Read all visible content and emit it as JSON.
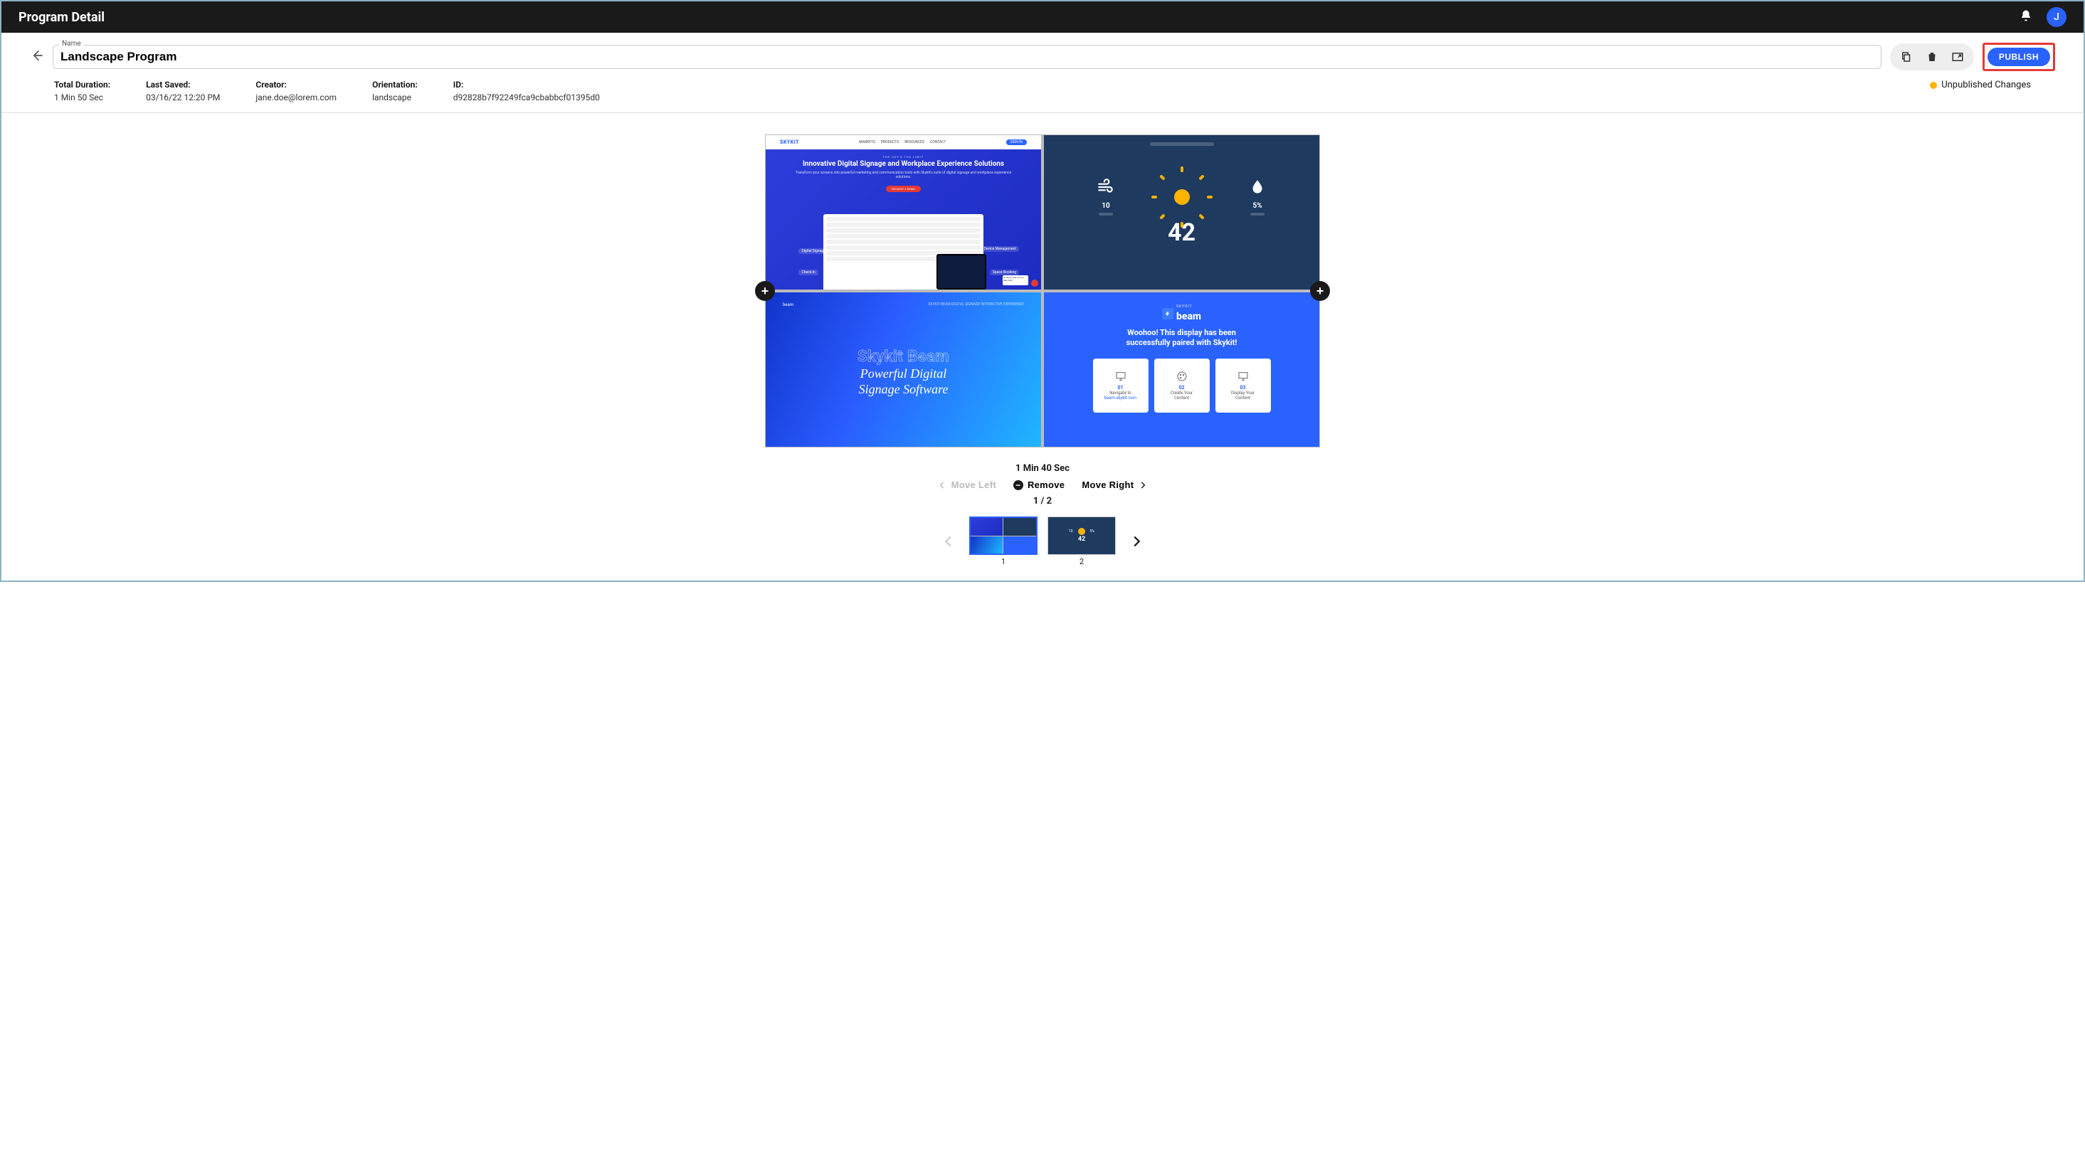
{
  "topbar": {
    "title": "Program Detail",
    "avatar_initial": "J"
  },
  "header": {
    "name_label": "Name",
    "name_value": "Landscape Program",
    "publish_label": "PUBLISH"
  },
  "meta": {
    "total_duration_label": "Total Duration:",
    "total_duration_value": "1 Min 50 Sec",
    "last_saved_label": "Last Saved:",
    "last_saved_value": "03/16/22 12:20 PM",
    "creator_label": "Creator:",
    "creator_value": "jane.doe@lorem.com",
    "orientation_label": "Orientation:",
    "orientation_value": "landscape",
    "id_label": "ID:",
    "id_value": "d92828b7f92249fca9cbabbcf01395d0",
    "unpublished_label": "Unpublished Changes"
  },
  "tiles": {
    "t1": {
      "logo": "SKYKIT",
      "nav": [
        "MARKETS",
        "PRODUCTS",
        "RESOURCES",
        "CONTACT"
      ],
      "signin": "SIGN IN",
      "tagline": "THE SKY'S THE LIMIT",
      "headline": "Innovative Digital Signage and Workplace Experience Solutions",
      "sub": "Transform your screens into powerful marketing and communication tools with Skykit's suite of digital signage and workplace experience solutions.",
      "cta": "REQUEST A DEMO",
      "pill_l1": "Digital Signage",
      "pill_l2": "Check-In",
      "pill_r1": "Device Management",
      "pill_r2": "Space Booking",
      "chat": "Hi there, what can we help with?"
    },
    "t2": {
      "wind": "10",
      "humidity": "5%",
      "temp": "42"
    },
    "t3": {
      "logo": "beam",
      "topright": "SKYKIT BEAM DIGITAL SIGNAGE    INTERACTIVE EXPERIENCE",
      "outline": "Skykit Beam",
      "serif1": "Powerful Digital",
      "serif2": "Signage Software"
    },
    "t4": {
      "brand_small": "SKYKIT",
      "brand": "beam",
      "msg1": "Woohoo! This display has been",
      "msg2": "successfully paired with Skykit!",
      "card1_num": "01",
      "card1_t": "Navigate to",
      "card1_link": "beam.skykit.com",
      "card2_num": "02",
      "card2_t1": "Create Your",
      "card2_t2": "Content",
      "card3_num": "03",
      "card3_t1": "Display Your",
      "card3_t2": "Content"
    }
  },
  "controls": {
    "current_duration": "1 Min 40 Sec",
    "move_left": "Move Left",
    "remove": "Remove",
    "move_right": "Move Right",
    "pager": "1 / 2"
  },
  "thumbs": {
    "t1_label": "1",
    "t2_label": "2",
    "t2_wind": "10",
    "t2_hum": "5%",
    "t2_temp": "42"
  }
}
